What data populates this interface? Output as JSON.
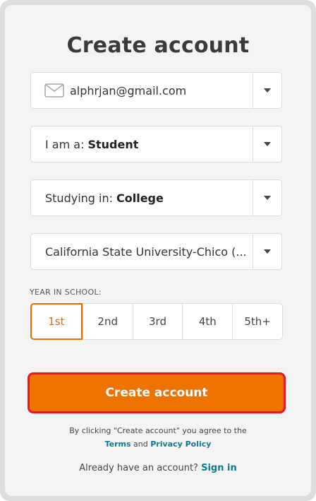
{
  "title": "Create account",
  "email": {
    "value": "alphrjan@gmail.com",
    "icon": "mail-icon"
  },
  "role": {
    "prefix": "I am a:",
    "value": "Student"
  },
  "studying": {
    "prefix": "Studying in:",
    "value": "College"
  },
  "school": {
    "value": "California State University-Chico (..."
  },
  "year_in_school": {
    "label": "YEAR IN SCHOOL:",
    "options": [
      "1st",
      "2nd",
      "3rd",
      "4th",
      "5th+"
    ],
    "selected": "1st"
  },
  "create_button": "Create account",
  "legal": {
    "text": "By clicking \"Create account\" you agree to the",
    "terms": "Terms",
    "and": "and",
    "privacy": "Privacy Policy"
  },
  "signin": {
    "text": "Already have an account?",
    "link": "Sign in"
  },
  "colors": {
    "accent": "#ee7300",
    "link": "#0f7a8c",
    "highlight_border": "#e8181f"
  }
}
